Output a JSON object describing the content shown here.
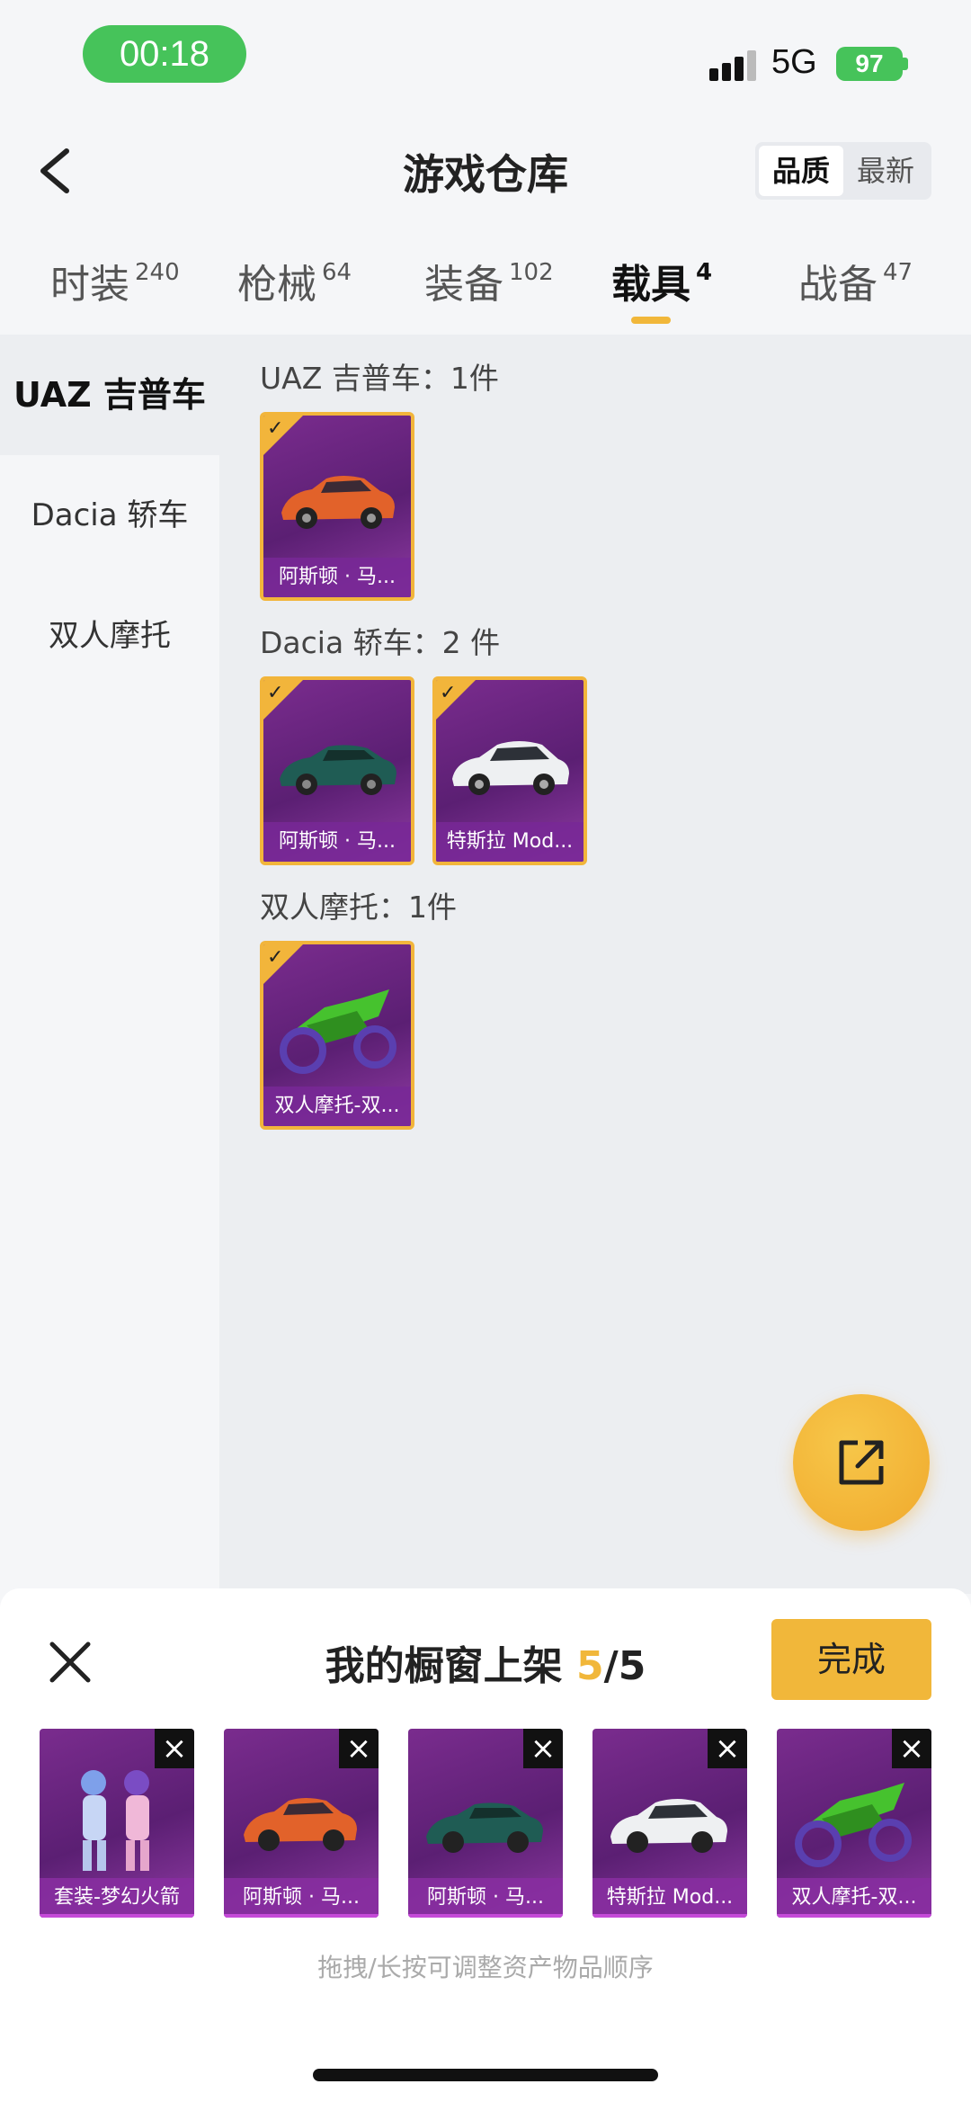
{
  "status_bar": {
    "time": "00:18",
    "network": "5G",
    "battery": "97"
  },
  "header": {
    "title": "游戏仓库",
    "sort_options": [
      "品质",
      "最新"
    ]
  },
  "tabs": [
    {
      "label": "时装",
      "count": "240"
    },
    {
      "label": "枪械",
      "count": "64"
    },
    {
      "label": "装备",
      "count": "102"
    },
    {
      "label": "载具",
      "count": "4"
    },
    {
      "label": "战备",
      "count": "47"
    }
  ],
  "sidebar": {
    "items": [
      {
        "label": "UAZ 吉普车"
      },
      {
        "label": "Dacia 轿车"
      },
      {
        "label": "双人摩托"
      }
    ]
  },
  "sections": [
    {
      "title": "UAZ 吉普车：1件",
      "items": [
        {
          "label": "阿斯顿 · 马...",
          "icon": "orange-car-icon"
        }
      ]
    },
    {
      "title": "Dacia 轿车：2 件",
      "items": [
        {
          "label": "阿斯顿 · 马...",
          "icon": "green-car-icon"
        },
        {
          "label": "特斯拉 Mod...",
          "icon": "white-car-icon"
        }
      ]
    },
    {
      "title": "双人摩托：1件",
      "items": [
        {
          "label": "双人摩托-双...",
          "icon": "green-motorcycle-icon"
        }
      ]
    }
  ],
  "sheet": {
    "title": "我的橱窗上架",
    "count": "5",
    "total": "/5",
    "done_label": "完成",
    "hint": "拖拽/长按可调整资产物品顺序",
    "items": [
      {
        "label": "套装-梦幻火箭",
        "icon": "outfit-icon"
      },
      {
        "label": "阿斯顿 · 马...",
        "icon": "orange-car-icon"
      },
      {
        "label": "阿斯顿 · 马...",
        "icon": "green-car-icon"
      },
      {
        "label": "特斯拉 Mod...",
        "icon": "white-car-icon"
      },
      {
        "label": "双人摩托-双...",
        "icon": "green-motorcycle-icon"
      }
    ]
  },
  "colors": {
    "accent": "#f1b73a",
    "card_purple": "#6b2482",
    "status_green": "#46c35a"
  }
}
